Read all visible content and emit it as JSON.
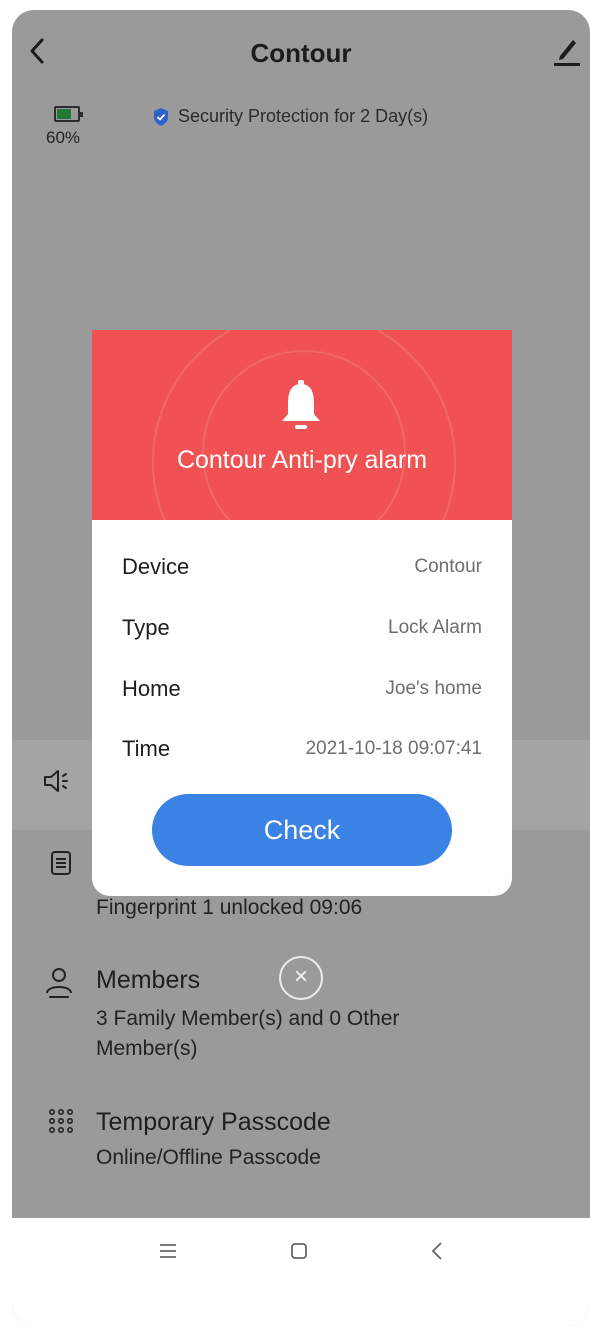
{
  "header": {
    "title": "Contour",
    "back_icon": "chevron-left-icon",
    "edit_icon": "pencil-icon"
  },
  "status": {
    "battery_percent": "60%",
    "battery_level": 0.6,
    "security_text": "Security Protection for 2 Day(s)"
  },
  "list": {
    "log_subtitle": "Fingerprint 1 unlocked 09:06",
    "members_title": "Members",
    "members_subtitle": "3 Family Member(s) and 0 Other Member(s)",
    "passcode_title": "Temporary Passcode",
    "passcode_subtitle": "Online/Offline Passcode"
  },
  "alarm": {
    "title": "Contour Anti-pry alarm",
    "rows": [
      {
        "label": "Device",
        "value": "Contour"
      },
      {
        "label": "Type",
        "value": "Lock Alarm"
      },
      {
        "label": "Home",
        "value": "Joe's home"
      },
      {
        "label": "Time",
        "value": "2021-10-18 09:07:41"
      }
    ],
    "check_label": "Check",
    "close_label": "×"
  },
  "colors": {
    "alarm_red": "#f05253",
    "check_blue": "#3a82e4",
    "overlay_gray": "#9a9a9a",
    "shield_blue": "#2f63c9",
    "battery_green": "#1f7a31"
  }
}
